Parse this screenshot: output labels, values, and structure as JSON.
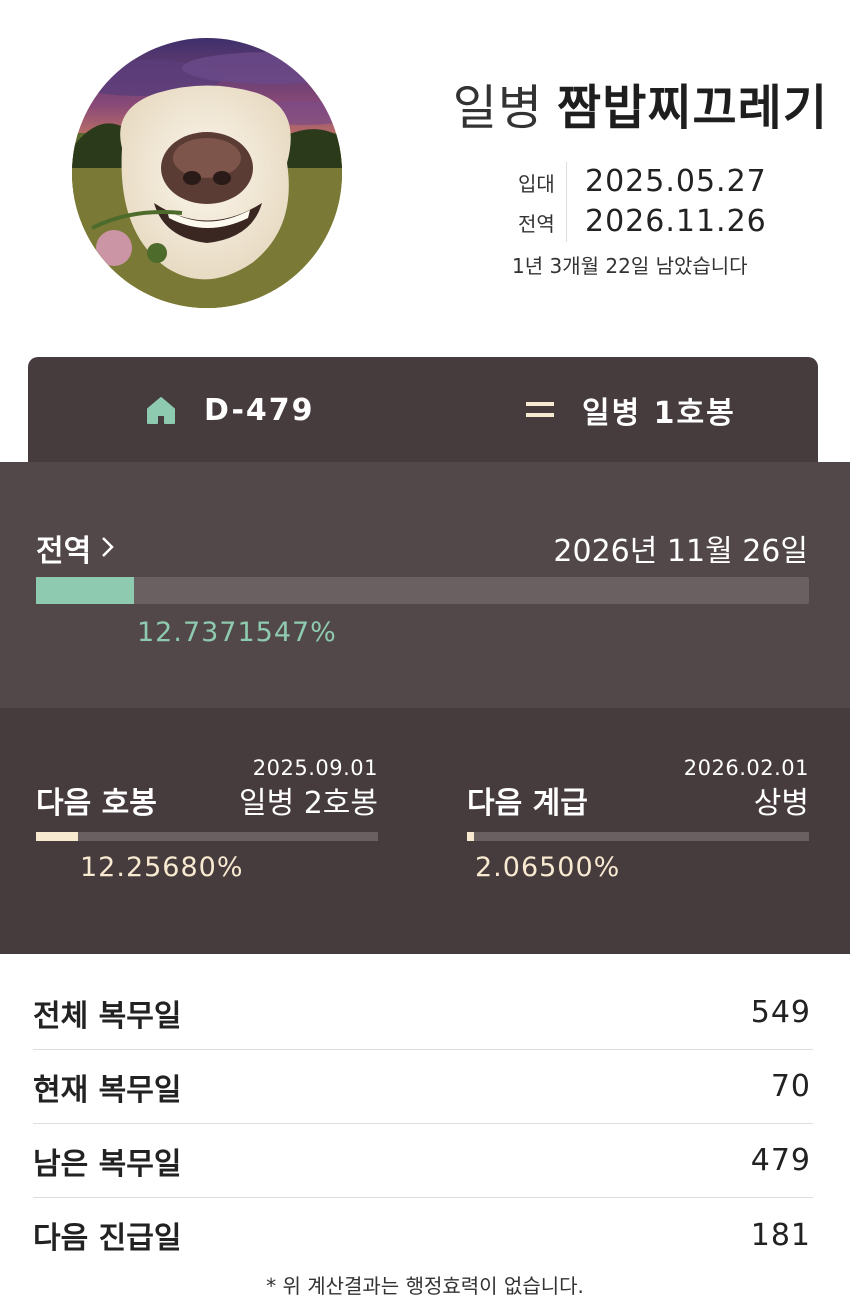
{
  "profile": {
    "rank": "일병",
    "nickname": "짬밥찌끄레기",
    "avatar_icon": "smiling-dog-photo",
    "enlist_label": "입대",
    "enlist_date": "2025.05.27",
    "discharge_label": "전역",
    "discharge_date": "2026.11.26",
    "remaining_text": "1년 3개월 22일 남았습니다"
  },
  "topbar": {
    "dday": "D-479",
    "dday_icon": "home-icon",
    "rank_step": "일병 1호봉",
    "rank_icon": "equals-icon",
    "bg": "#463b3d"
  },
  "discharge": {
    "label": "전역",
    "chevron": ">",
    "date_text": "2026년 11월 26일",
    "progress": 0.127371547,
    "percent_text": "12.7371547%",
    "accent": "#8ecab0"
  },
  "next_step": {
    "title": "다음 호봉",
    "date": "2025.09.01",
    "target": "일병 2호봉",
    "progress": 0.122568,
    "percent_text": "12.25680%"
  },
  "next_rank": {
    "title": "다음 계급",
    "date": "2026.02.01",
    "target": "상병",
    "progress": 0.02065,
    "percent_text": "2.06500%"
  },
  "stats": [
    {
      "label": "전체 복무일",
      "value": "549"
    },
    {
      "label": "현재 복무일",
      "value": "70"
    },
    {
      "label": "남은 복무일",
      "value": "479"
    },
    {
      "label": "다음 진급일",
      "value": "181"
    }
  ],
  "footnote": "* 위 계산결과는 행정효력이 없습니다."
}
